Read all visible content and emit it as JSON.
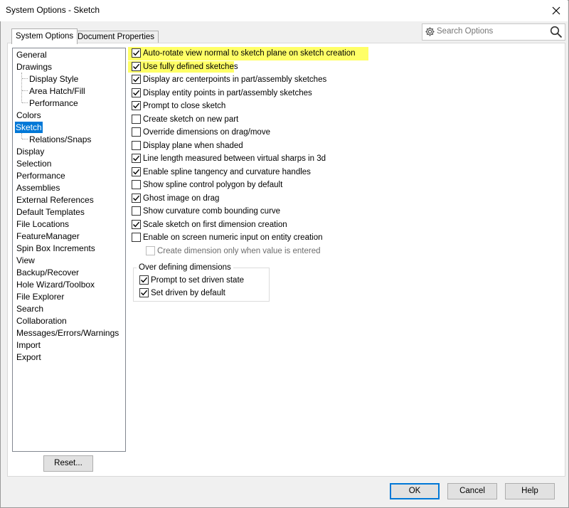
{
  "window": {
    "title": "System Options - Sketch"
  },
  "tabs": [
    {
      "label": "System Options",
      "active": true
    },
    {
      "label": "Document Properties",
      "active": false
    }
  ],
  "search": {
    "placeholder": "Search Options",
    "icons": [
      "gear-icon",
      "search-icon"
    ]
  },
  "tree": {
    "items": [
      {
        "label": "General"
      },
      {
        "label": "Drawings"
      },
      {
        "label": "Display Style"
      },
      {
        "label": "Area Hatch/Fill"
      },
      {
        "label": "Performance"
      },
      {
        "label": "Colors"
      },
      {
        "label": "Sketch",
        "selected": true
      },
      {
        "label": "Relations/Snaps"
      },
      {
        "label": "Display"
      },
      {
        "label": "Selection"
      },
      {
        "label": "Performance"
      },
      {
        "label": "Assemblies"
      },
      {
        "label": "External References"
      },
      {
        "label": "Default Templates"
      },
      {
        "label": "File Locations"
      },
      {
        "label": "FeatureManager"
      },
      {
        "label": "Spin Box Increments"
      },
      {
        "label": "View"
      },
      {
        "label": "Backup/Recover"
      },
      {
        "label": "Hole Wizard/Toolbox"
      },
      {
        "label": "File Explorer"
      },
      {
        "label": "Search"
      },
      {
        "label": "Collaboration"
      },
      {
        "label": "Messages/Errors/Warnings"
      },
      {
        "label": "Import"
      },
      {
        "label": "Export"
      }
    ]
  },
  "options": [
    {
      "label": "Auto-rotate view normal to sketch plane on sketch creation",
      "checked": true,
      "highlighted": true
    },
    {
      "label": "Use fully defined sketches",
      "checked": true,
      "highlighted": true
    },
    {
      "label": "Display arc centerpoints in part/assembly sketches",
      "checked": true
    },
    {
      "label": "Display entity points in part/assembly sketches",
      "checked": true
    },
    {
      "label": "Prompt to close sketch",
      "checked": true
    },
    {
      "label": "Create sketch on new part",
      "checked": false
    },
    {
      "label": "Override dimensions on drag/move",
      "checked": false
    },
    {
      "label": "Display plane when shaded",
      "checked": false
    },
    {
      "label": "Line length measured between virtual sharps in 3d",
      "checked": true
    },
    {
      "label": "Enable spline tangency and curvature handles",
      "checked": true
    },
    {
      "label": "Show spline control polygon by default",
      "checked": false
    },
    {
      "label": "Ghost image on drag",
      "checked": true
    },
    {
      "label": "Show curvature comb bounding curve",
      "checked": false
    },
    {
      "label": "Scale sketch on first dimension creation",
      "checked": true
    },
    {
      "label": "Enable on screen numeric input on entity creation",
      "checked": false
    },
    {
      "label": "Create dimension only when value is entered",
      "checked": false,
      "disabled": true
    }
  ],
  "group": {
    "title": "Over defining dimensions",
    "options": [
      {
        "label": "Prompt to set driven state",
        "checked": true
      },
      {
        "label": "Set driven by default",
        "checked": true
      }
    ]
  },
  "buttons": {
    "reset": "Reset...",
    "ok": "OK",
    "cancel": "Cancel",
    "help": "Help"
  },
  "colors": {
    "highlight": "#ffff66",
    "selection": "#0078d7"
  }
}
